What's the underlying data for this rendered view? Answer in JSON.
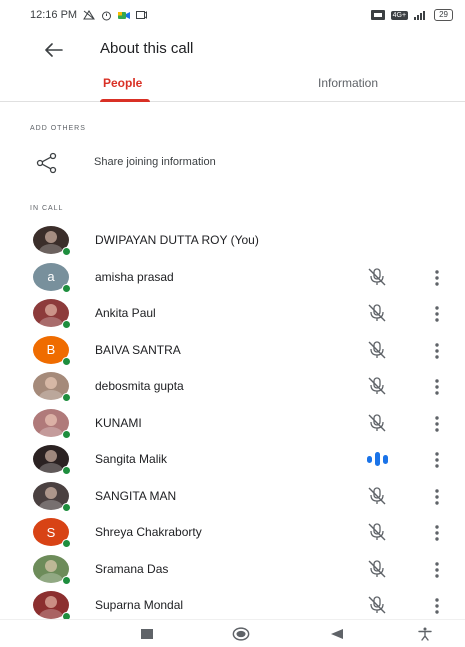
{
  "status_bar": {
    "time": "12:16 PM",
    "network": "4G+",
    "battery": "29"
  },
  "header": {
    "title": "About this call",
    "back_icon": "arrow-left-icon"
  },
  "tabs": [
    {
      "label": "People",
      "active": true
    },
    {
      "label": "Information",
      "active": false
    }
  ],
  "add_others": {
    "section_label": "ADD OTHERS",
    "share_label": "Share joining information",
    "icon": "share-icon"
  },
  "in_call": {
    "section_label": "IN CALL",
    "participants": [
      {
        "name": "DWIPAYAN DUTTA ROY (You)",
        "avatar": "photo",
        "color": "#3b2e2a",
        "mic": "none"
      },
      {
        "name": "amisha prasad",
        "avatar": "a",
        "color": "#78909c",
        "mic": "muted"
      },
      {
        "name": "Ankita Paul",
        "avatar": "photo",
        "color": "#8d3b3b",
        "mic": "muted"
      },
      {
        "name": "BAIVA SANTRA",
        "avatar": "B",
        "color": "#ef6c00",
        "mic": "muted"
      },
      {
        "name": "debosmita gupta",
        "avatar": "photo",
        "color": "#a58a7a",
        "mic": "muted"
      },
      {
        "name": "KUNAMI",
        "avatar": "photo",
        "color": "#b07a7a",
        "mic": "muted"
      },
      {
        "name": "Sangita Malik",
        "avatar": "photo",
        "color": "#2b2222",
        "mic": "speaking"
      },
      {
        "name": "SANGITA MAN",
        "avatar": "photo",
        "color": "#4a4040",
        "mic": "muted"
      },
      {
        "name": "Shreya Chakraborty",
        "avatar": "S",
        "color": "#d84315",
        "mic": "muted"
      },
      {
        "name": "Sramana Das",
        "avatar": "photo",
        "color": "#6d8c5a",
        "mic": "muted"
      },
      {
        "name": "Suparna Mondal",
        "avatar": "photo",
        "color": "#8c2f2f",
        "mic": "muted"
      }
    ]
  },
  "colors": {
    "accent": "#d93025",
    "online": "#1e8e3e",
    "speaking": "#1a73e8",
    "muted_icon": "#5f6368"
  },
  "nav_bar": {
    "icons": [
      "recents-icon",
      "home-icon",
      "back-icon",
      "accessibility-icon"
    ]
  }
}
